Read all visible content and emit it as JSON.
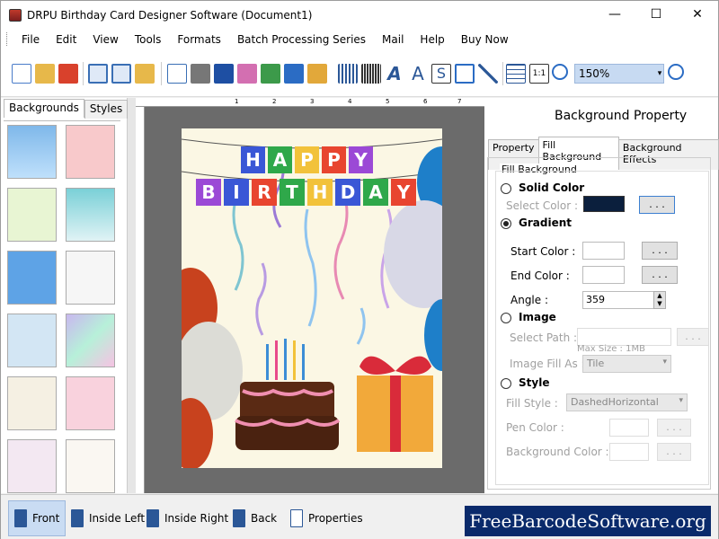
{
  "window": {
    "title": "DRPU Birthday Card Designer Software (Document1)",
    "min": "—",
    "max": "☐",
    "close": "✕"
  },
  "menu": [
    "File",
    "Edit",
    "View",
    "Tools",
    "Formats",
    "Batch Processing Series",
    "Mail",
    "Help",
    "Buy Now"
  ],
  "toolbar": {
    "zoom": "150%"
  },
  "left_panel": {
    "tabs": [
      "Backgrounds",
      "Styles"
    ]
  },
  "canvas": {
    "ruler_nums": [
      "1",
      "2",
      "3",
      "4",
      "5",
      "6",
      "7"
    ],
    "banner_top": [
      "H",
      "A",
      "P",
      "P",
      "Y"
    ],
    "banner_bottom": [
      "B",
      "I",
      "R",
      "T",
      "H",
      "D",
      "A",
      "Y"
    ]
  },
  "right_panel": {
    "title": "Background Property",
    "tabs": [
      "Property",
      "Fill Background",
      "Background Effects"
    ],
    "group_title": "Fill Background",
    "solid_color": "Solid Color",
    "select_color": "Select Color :",
    "dots": ". . .",
    "gradient": "Gradient",
    "start_color": "Start Color :",
    "end_color": "End Color :",
    "angle": "Angle :",
    "angle_value": "359",
    "image": "Image",
    "select_path": "Select Path :",
    "max_size": "Max Size : 1MB",
    "image_fill_as": "Image Fill As :",
    "image_fill_value": "Tile",
    "style": "Style",
    "fill_style": "Fill Style :",
    "fill_style_value": "DashedHorizontal",
    "pen_color": "Pen Color :",
    "background_color": "Background Color :"
  },
  "bottom": {
    "front": "Front",
    "inside_left": "Inside Left",
    "inside_right": "Inside Right",
    "back": "Back",
    "properties": "Properties",
    "brand": "FreeBarcodeSoftware.org"
  },
  "colors": {
    "selected_color": "#0b1f3d",
    "zoom_bg": "#c7daf2",
    "brand_bg": "#0a2a6b"
  }
}
